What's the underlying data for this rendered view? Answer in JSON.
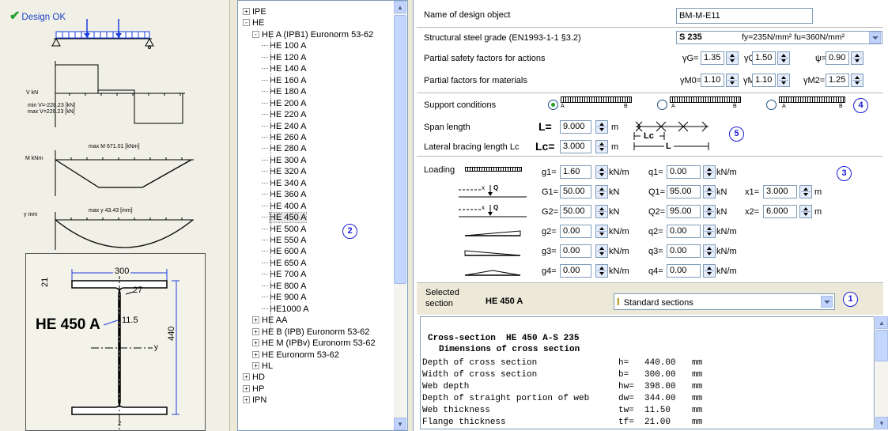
{
  "left": {
    "status": "Design OK",
    "shear_axis": "V kN",
    "shear_min": "min V=-228.23 [kN]",
    "shear_max": "max V=228.23 [kN]",
    "moment_axis": "M kNm",
    "moment_max": "max M 671.01 [kNm]",
    "defl_axis": "y mm",
    "defl_max": "max y 43.43 [mm]",
    "section": {
      "name": "HE 450 A",
      "width": "300",
      "height": "440",
      "flange": "21",
      "radius": "27",
      "web": "11.5",
      "axis_y": "y",
      "axis_z": "z"
    }
  },
  "tree": {
    "items": [
      {
        "label": "IPE",
        "exp": "+"
      },
      {
        "label": "HE",
        "exp": "-"
      },
      {
        "label": "HE A (IPB1)  Euronorm 53-62",
        "exp": "-"
      },
      {
        "label": "HE 100 A"
      },
      {
        "label": "HE 120 A"
      },
      {
        "label": "HE 140 A"
      },
      {
        "label": "HE 160 A"
      },
      {
        "label": "HE 180 A"
      },
      {
        "label": "HE 200 A"
      },
      {
        "label": "HE 220 A"
      },
      {
        "label": "HE 240 A"
      },
      {
        "label": "HE 260 A"
      },
      {
        "label": "HE 280 A"
      },
      {
        "label": "HE 300 A"
      },
      {
        "label": "HE 320 A"
      },
      {
        "label": "HE 340 A"
      },
      {
        "label": "HE 360 A"
      },
      {
        "label": "HE 400 A"
      },
      {
        "label": "HE 450 A"
      },
      {
        "label": "HE 500 A"
      },
      {
        "label": "HE 550 A"
      },
      {
        "label": "HE 600 A"
      },
      {
        "label": "HE 650 A"
      },
      {
        "label": "HE 700 A"
      },
      {
        "label": "HE 800 A"
      },
      {
        "label": "HE 900 A"
      },
      {
        "label": "HE1000 A"
      },
      {
        "label": "HE AA",
        "exp": "+"
      },
      {
        "label": "HE B (IPB)  Euronorm 53-62",
        "exp": "+"
      },
      {
        "label": "HE M (IPBv)  Euronorm 53-62",
        "exp": "+"
      },
      {
        "label": "HE  Euronorm 53-62",
        "exp": "+"
      },
      {
        "label": "HL",
        "exp": "+"
      },
      {
        "label": "HD",
        "exp": "+"
      },
      {
        "label": "HP",
        "exp": "+"
      },
      {
        "label": "IPN",
        "exp": "+"
      }
    ],
    "selected": "HE 450 A",
    "badge": "2"
  },
  "form": {
    "name_label": "Name of design object",
    "name_value": "BM-M-E11",
    "grade_label": "Structural steel grade (EN1993-1-1 §3.2)",
    "grade_value": "S 235",
    "grade_props": "fy=235N/mm² fu=360N/mm²",
    "psf_label": "Partial safety factors for actions",
    "gamma_g_label": "γG=",
    "gamma_g": "1.35",
    "gamma_q_label": "γQ=",
    "gamma_q": "1.50",
    "psi_label": "ψ=",
    "psi": "0.90",
    "pfm_label": "Partial factors for materials",
    "gm0_label": "γM0=",
    "gm0": "1.10",
    "gm1_label": "γM1=",
    "gm1": "1.10",
    "gm2_label": "γM2=",
    "gm2": "1.25",
    "support_label": "Support conditions",
    "support_a": "A",
    "support_b": "B",
    "badge4": "4",
    "span_label": "Span length",
    "L_label": "L=",
    "L_value": "9.000",
    "m1": "m",
    "lc_label": "Lateral bracing length Lc",
    "Lc_label": "Lc=",
    "Lc_value": "3.000",
    "m2": "m",
    "lc_diag": "Lc",
    "l_diag": "L",
    "badge5": "5",
    "loading_label": "Loading",
    "badge3": "3",
    "loads": [
      {
        "l1": "g1=",
        "v1": "1.60",
        "u1": "kN/m",
        "l2": "q1=",
        "v2": "0.00",
        "u2": "kN/m"
      },
      {
        "l1": "G1=",
        "v1": "50.00",
        "u1": "kN",
        "l2": "Q1=",
        "v2": "95.00",
        "u2": "kN",
        "l3": "x1=",
        "v3": "3.000",
        "u3": "m"
      },
      {
        "l1": "G2=",
        "v1": "50.00",
        "u1": "kN",
        "l2": "Q2=",
        "v2": "95.00",
        "u2": "kN",
        "l3": "x2=",
        "v3": "6.000",
        "u3": "m"
      },
      {
        "l1": "g2=",
        "v1": "0.00",
        "u1": "kN/m",
        "l2": "q2=",
        "v2": "0.00",
        "u2": "kN/m"
      },
      {
        "l1": "g3=",
        "v1": "0.00",
        "u1": "kN/m",
        "l2": "q3=",
        "v2": "0.00",
        "u2": "kN/m"
      },
      {
        "l1": "g4=",
        "v1": "0.00",
        "u1": "kN/m",
        "l2": "q4=",
        "v2": "0.00",
        "u2": "kN/m"
      }
    ],
    "point_x": "x",
    "point_q": "Q",
    "selected_label_1": "Selected",
    "selected_label_2": "section",
    "selected_value": "HE 450 A",
    "section_type": "Standard sections",
    "badge1": "1"
  },
  "report": {
    "title": "Cross-section  HE 450 A-S 235",
    "subtitle": "Dimensions of cross section",
    "rows": [
      {
        "name": "Depth of cross section",
        "sym": "h=",
        "val": "440.00",
        "unit": "mm"
      },
      {
        "name": "Width of cross section",
        "sym": "b=",
        "val": "300.00",
        "unit": "mm"
      },
      {
        "name": "Web depth",
        "sym": "hw=",
        "val": "398.00",
        "unit": "mm"
      },
      {
        "name": "Depth of straight portion of web",
        "sym": "dw=",
        "val": "344.00",
        "unit": "mm"
      },
      {
        "name": "Web thickness",
        "sym": "tw=",
        "val": "11.50",
        "unit": "mm"
      },
      {
        "name": "Flange thickness",
        "sym": "tf=",
        "val": "21.00",
        "unit": "mm"
      }
    ]
  }
}
